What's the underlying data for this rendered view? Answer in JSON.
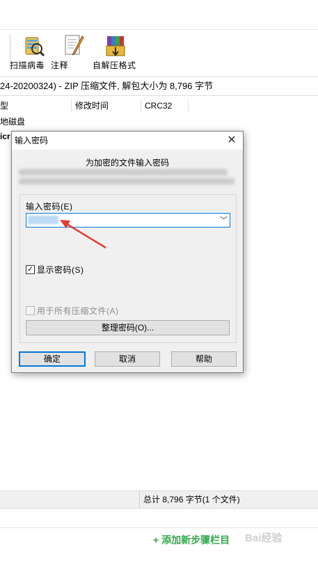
{
  "toolbar": {
    "buttons": [
      {
        "label": "扫描病毒",
        "icon": "antivirus-scan-icon"
      },
      {
        "label": "注释",
        "icon": "comment-icon"
      },
      {
        "label": "自解压格式",
        "icon": "sfx-archive-icon"
      }
    ]
  },
  "archive_title": "24-20200324) - ZIP 压缩文件, 解包大小为 8,796 字节",
  "file_list": {
    "columns": [
      "型",
      "修改时间",
      "CRC32"
    ],
    "rows": [
      "地磁盘",
      "icr"
    ]
  },
  "status": {
    "total": "总计 8,796 字节(1 个文件)"
  },
  "footer": {
    "add_step": "+ 添加新步骤栏目",
    "watermark": "Bai经验"
  },
  "dialog": {
    "title": "输入密码",
    "heading": "为加密的文件输入密码",
    "password_label": "输入密码(E)",
    "show_password": {
      "label": "显示密码(S)",
      "checked": true
    },
    "use_for_all": {
      "label": "用于所有压缩文件(A)",
      "checked": false,
      "enabled": false
    },
    "organize_button": "整理密码(O)...",
    "buttons": {
      "ok": "确定",
      "cancel": "取消",
      "help": "帮助"
    }
  },
  "colors": {
    "accent": "#0078d7",
    "annotation_arrow": "#e03c31",
    "add_step_green": "#31a84a"
  }
}
